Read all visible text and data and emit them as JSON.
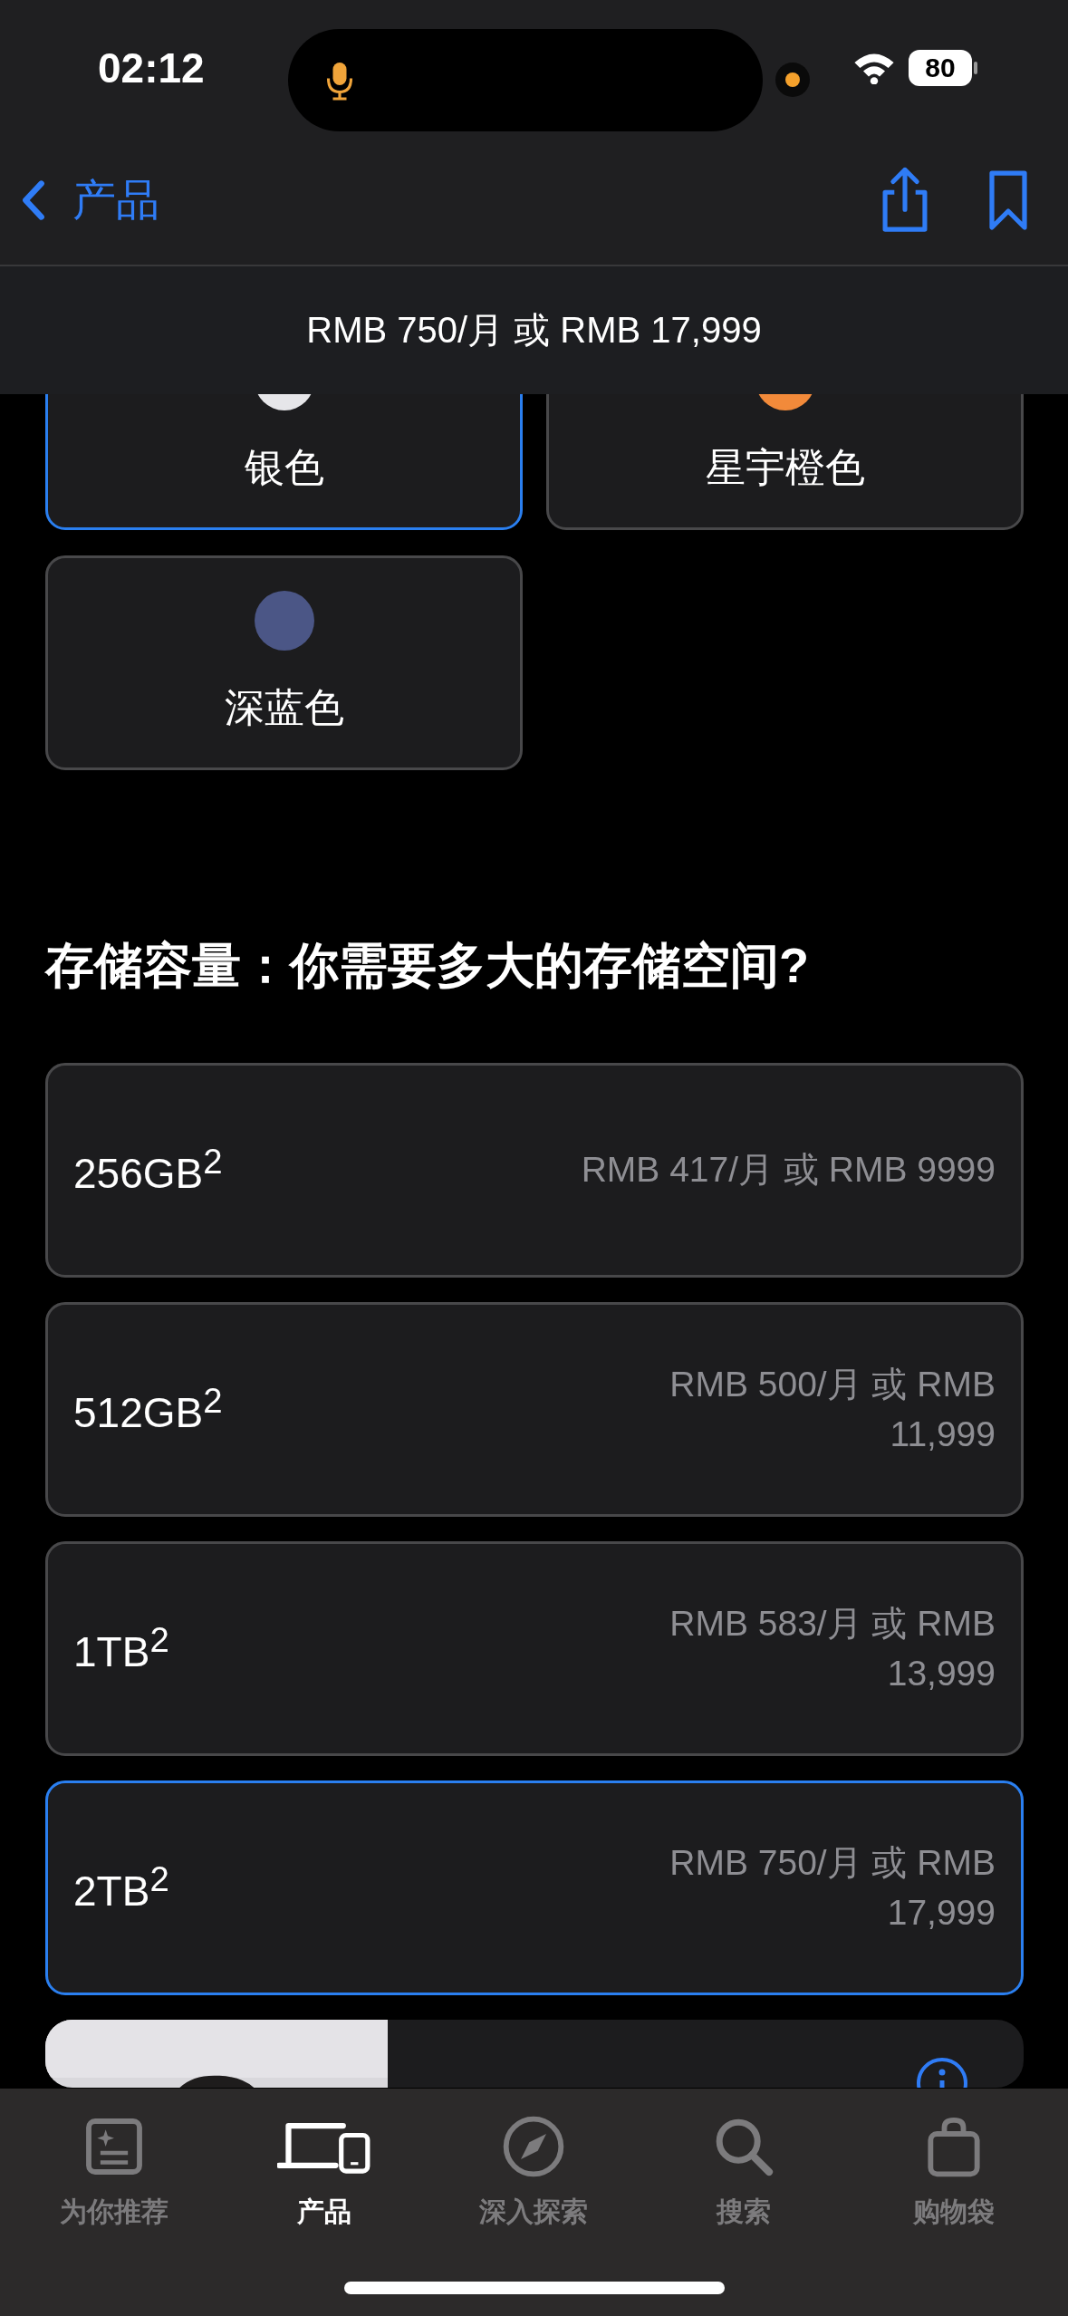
{
  "status_bar": {
    "time": "02:12",
    "battery": "80"
  },
  "nav": {
    "back_label": "产品"
  },
  "price_bar": {
    "text": "RMB 750/月 或 RMB 17,999"
  },
  "colors": [
    {
      "name": "银色",
      "color": "#e6e6e9",
      "selected": true
    },
    {
      "name": "星宇橙色",
      "color": "#f28a3a",
      "selected": false
    },
    {
      "name": "深蓝色",
      "color": "#4b5686",
      "selected": false
    }
  ],
  "storage": {
    "heading": "存储容量：你需要多大的存储空间?",
    "options": [
      {
        "capacity": "256GB$^{2}$",
        "price": "RMB 417/月 或 RMB 9999",
        "selected": false
      },
      {
        "capacity": "512GB$^{2}$",
        "price": "RMB 500/月 或 RMB 11,999",
        "selected": false
      },
      {
        "capacity": "1TB$^{2}$",
        "price": "RMB 583/月 或 RMB 13,999",
        "selected": false
      },
      {
        "capacity": "2TB$^{2}$",
        "price": "RMB 750/月 或 RMB 17,999",
        "selected": true
      }
    ]
  },
  "tabs": [
    {
      "label": "为你推荐",
      "kind": "sparkle",
      "selected": false
    },
    {
      "label": "产品",
      "kind": "devices",
      "selected": true
    },
    {
      "label": "深入探索",
      "kind": "compass",
      "selected": false
    },
    {
      "label": "搜索",
      "kind": "search",
      "selected": false
    },
    {
      "label": "购物袋",
      "kind": "bag",
      "selected": false
    }
  ]
}
